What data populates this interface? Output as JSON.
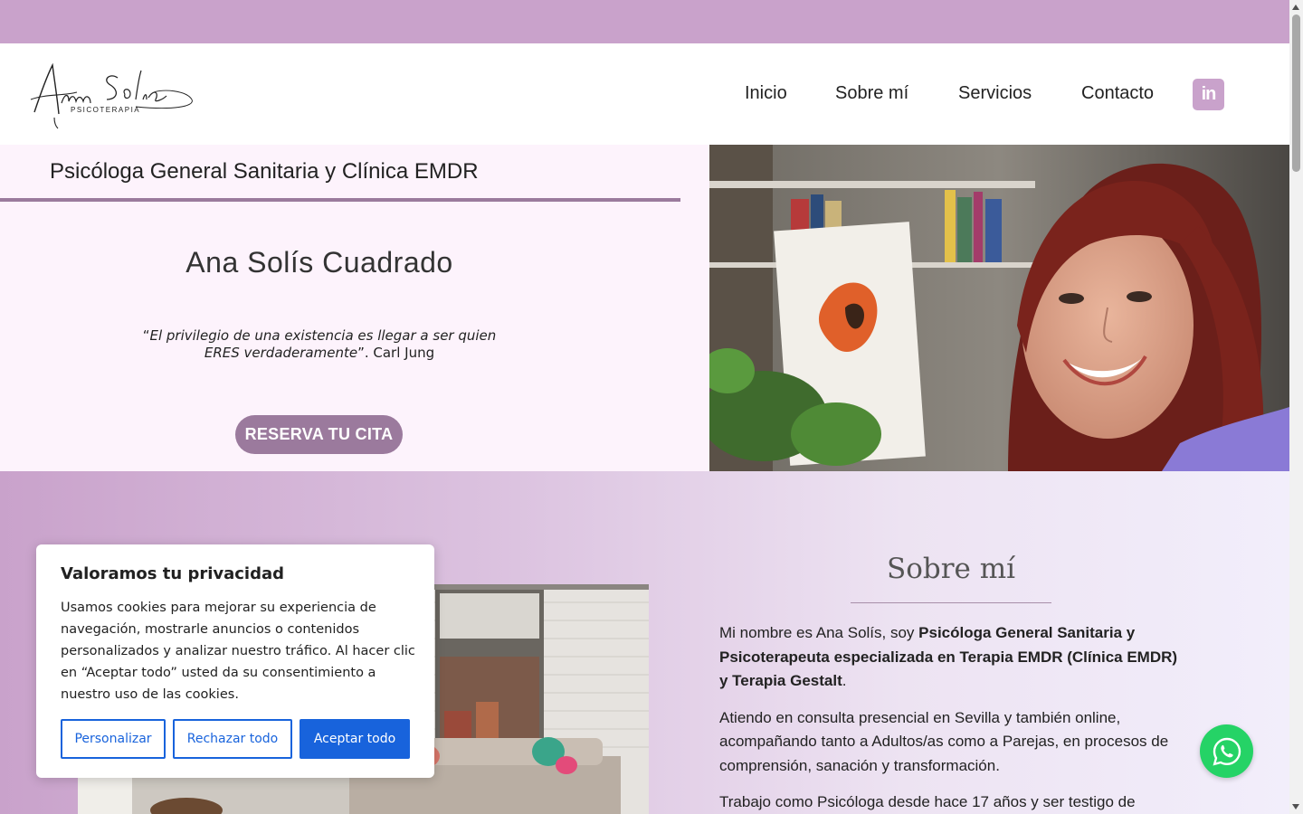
{
  "header": {
    "logo": {
      "name": "Ana Solís",
      "subtitle": "PSICOTERAPIA"
    },
    "nav": [
      {
        "label": "Inicio"
      },
      {
        "label": "Sobre mí"
      },
      {
        "label": "Servicios"
      },
      {
        "label": "Contacto"
      }
    ],
    "social_icon": "linkedin-icon",
    "social_label": "in"
  },
  "hero": {
    "subtitle": "Psicóloga General Sanitaria y Clínica EMDR",
    "name": "Ana Solís Cuadrado",
    "quote_open": "“",
    "quote_italic": "El privilegio de una existencia es llegar a ser quien ERES verdaderamente",
    "quote_close": "”. Carl Jung",
    "cta_label": "RESERVA TU CITA"
  },
  "about": {
    "title": "Sobre mí",
    "p1_plain": "Mi nombre es Ana Solís, soy ",
    "p1_bold": "Psicóloga General Sanitaria y Psicoterapeuta especializada en Terapia EMDR  (Clínica EMDR) y Terapia Gestalt",
    "p1_end": ".",
    "p2": "Atiendo en consulta presencial en Sevilla y también online, acompañando tanto a Adultos/as como a Parejas, en procesos de comprensión, sanación y transformación.",
    "p3": "Trabajo como Psicóloga desde hace 17 años y ser testigo de"
  },
  "cookie_banner": {
    "title": "Valoramos tu privacidad",
    "body": "Usamos cookies para mejorar su experiencia de navegación, mostrarle anuncios o contenidos personalizados y analizar nuestro tráfico. Al hacer clic en “Aceptar todo” usted da su consentimiento a nuestro uso de las cookies.",
    "customize_label": "Personalizar",
    "reject_label": "Rechazar todo",
    "accept_label": "Aceptar todo"
  },
  "floating": {
    "whatsapp_icon": "whatsapp-icon"
  },
  "colors": {
    "brand_mauve": "#c9a2cb",
    "button_mauve": "#9b7a9d",
    "hero_bg": "#fdf3fc",
    "cookie_blue": "#1863dc",
    "whatsapp_green": "#25d366"
  }
}
